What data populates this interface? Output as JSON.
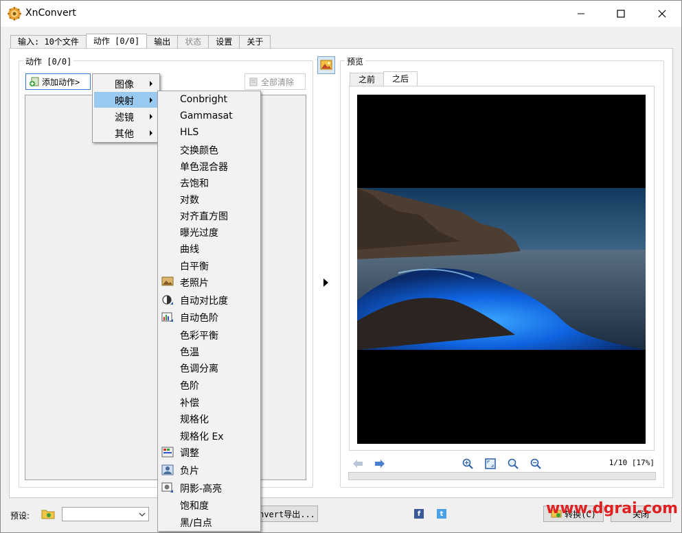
{
  "window": {
    "title": "XnConvert"
  },
  "tabs": [
    {
      "label": "输入: 10个文件",
      "active": false,
      "disabled": false
    },
    {
      "label": "动作 [0/0]",
      "active": true,
      "disabled": false
    },
    {
      "label": "输出",
      "active": false,
      "disabled": false
    },
    {
      "label": "状态",
      "active": false,
      "disabled": true
    },
    {
      "label": "设置",
      "active": false,
      "disabled": false
    },
    {
      "label": "关于",
      "active": false,
      "disabled": false
    }
  ],
  "actions": {
    "group_title": "动作 [0/0]",
    "add_button": "添加动作>",
    "clear_button": "全部清除"
  },
  "menu": {
    "items": [
      "图像",
      "映射",
      "滤镜",
      "其他"
    ],
    "highlighted": "映射"
  },
  "submenu": {
    "items": [
      {
        "label": "Conbright",
        "icon": ""
      },
      {
        "label": "Gammasat",
        "icon": ""
      },
      {
        "label": "HLS",
        "icon": ""
      },
      {
        "label": "交换颜色",
        "icon": ""
      },
      {
        "label": "单色混合器",
        "icon": ""
      },
      {
        "label": "去饱和",
        "icon": ""
      },
      {
        "label": "对数",
        "icon": ""
      },
      {
        "label": "对齐直方图",
        "icon": ""
      },
      {
        "label": "曝光过度",
        "icon": ""
      },
      {
        "label": "曲线",
        "icon": ""
      },
      {
        "label": "白平衡",
        "icon": ""
      },
      {
        "label": "老照片",
        "icon": "old-photo-icon"
      },
      {
        "label": "自动对比度",
        "icon": "auto-contrast-icon"
      },
      {
        "label": "自动色阶",
        "icon": "auto-levels-icon"
      },
      {
        "label": "色彩平衡",
        "icon": ""
      },
      {
        "label": "色温",
        "icon": ""
      },
      {
        "label": "色调分离",
        "icon": ""
      },
      {
        "label": "色阶",
        "icon": ""
      },
      {
        "label": "补偿",
        "icon": ""
      },
      {
        "label": "规格化",
        "icon": ""
      },
      {
        "label": "规格化 Ex",
        "icon": ""
      },
      {
        "label": "调整",
        "icon": "adjust-icon"
      },
      {
        "label": "负片",
        "icon": "negative-icon"
      },
      {
        "label": "阴影-高亮",
        "icon": "shadow-highlight-icon"
      },
      {
        "label": "饱和度",
        "icon": ""
      },
      {
        "label": "黑/白点",
        "icon": ""
      }
    ]
  },
  "preview": {
    "group_title": "预览",
    "tabs": [
      {
        "label": "之前",
        "active": false
      },
      {
        "label": "之后",
        "active": true
      }
    ],
    "counter": "1/10 [17%]"
  },
  "bottom": {
    "preset_label": "预设:",
    "preset_value": "",
    "export_button": "nvert导出...",
    "convert_button": "转换(C)",
    "close_button": "关闭"
  },
  "watermark": "www.dgrai.com",
  "colors": {
    "menu_highlight": "#99c9ef",
    "accent": "#3b78d4",
    "watermark": "#e02020"
  }
}
